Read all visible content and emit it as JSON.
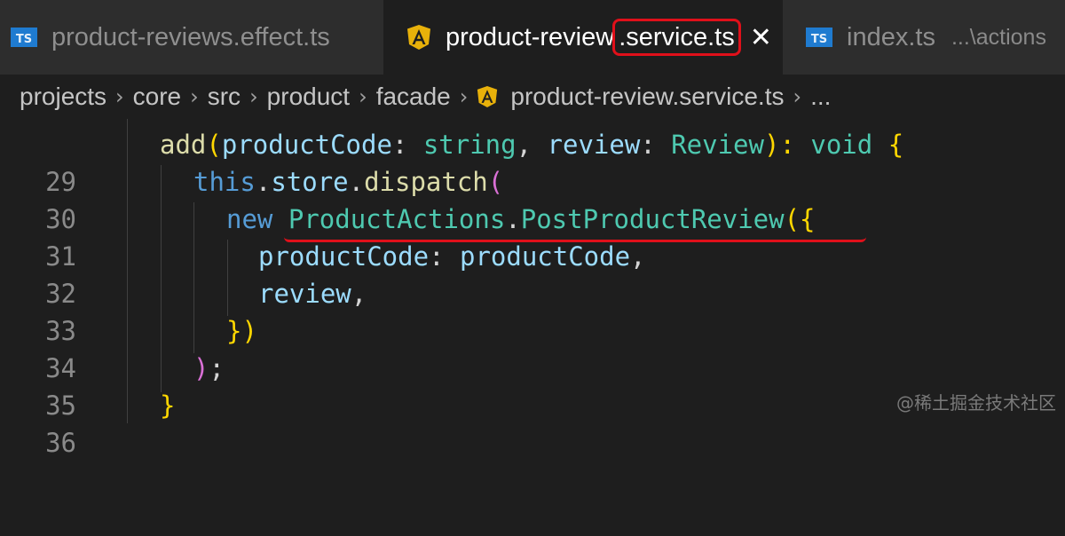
{
  "tabs": [
    {
      "label": "product-reviews.effect.ts",
      "icon": "ts-icon"
    },
    {
      "label_prefix": "product-review",
      "label_highlight": ".service.ts",
      "icon": "angular-icon",
      "active": true
    },
    {
      "label": "index.ts",
      "description": "...\\actions",
      "icon": "ts-icon"
    }
  ],
  "ts_icon_text": "TS",
  "close_glyph": "✕",
  "breadcrumb": [
    "projects",
    "core",
    "src",
    "product",
    "facade",
    "product-review.service.ts",
    "..."
  ],
  "code_lines": [
    {
      "n": "29"
    },
    {
      "n": "30"
    },
    {
      "n": "31"
    },
    {
      "n": "32"
    },
    {
      "n": "33"
    },
    {
      "n": "34"
    },
    {
      "n": "35"
    },
    {
      "n": "36"
    }
  ],
  "tokens": {
    "l29": [
      "add",
      "(",
      "productCode",
      ": ",
      "string",
      ", ",
      "review",
      ": ",
      "Review",
      "): ",
      "void",
      " ",
      "{"
    ],
    "l30": [
      "this",
      ".",
      "store",
      ".",
      "dispatch",
      "("
    ],
    "l31": [
      "new",
      " ",
      "ProductActions",
      ".",
      "PostProductReview",
      "(",
      "{"
    ],
    "l32": [
      "productCode",
      ": ",
      "productCode",
      ","
    ],
    "l33": [
      "review",
      ","
    ],
    "l34": [
      "}",
      ")"
    ],
    "l35": [
      ")",
      ";"
    ],
    "l36": [
      "}"
    ]
  },
  "watermark": "@稀土掘金技术社区",
  "colors": {
    "highlight": "#e0101a",
    "ts_blue": "#1f7bd0",
    "angular_red": "#dd0031"
  }
}
